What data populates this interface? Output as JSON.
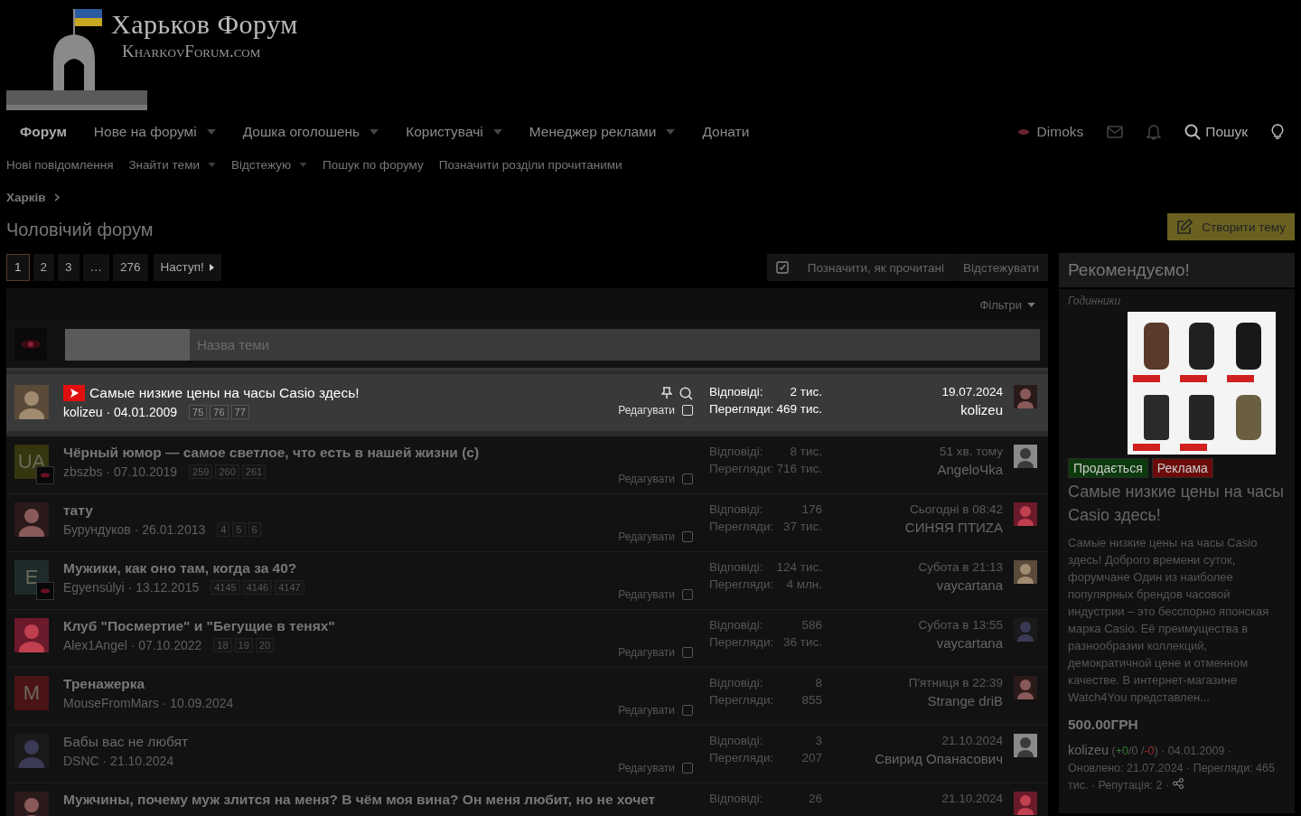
{
  "logo": {
    "title": "Харьков Форум",
    "subtitle": "KharkovForum.com"
  },
  "nav": [
    {
      "label": "Форум",
      "selected": true,
      "dropdown": false
    },
    {
      "label": "Нове на форумі",
      "selected": false,
      "dropdown": true
    },
    {
      "label": "Дошка оголошень",
      "selected": false,
      "dropdown": true
    },
    {
      "label": "Користувачі",
      "selected": false,
      "dropdown": true
    },
    {
      "label": "Менеджер реклами",
      "selected": false,
      "dropdown": true
    },
    {
      "label": "Донати",
      "selected": false,
      "dropdown": false
    }
  ],
  "user": {
    "name": "Dimoks"
  },
  "search_label": "Пошук",
  "subnav": [
    {
      "label": "Нові повідомлення",
      "dropdown": false
    },
    {
      "label": "Знайти теми",
      "dropdown": true
    },
    {
      "label": "Відстежую",
      "dropdown": true
    },
    {
      "label": "Пошук по форуму",
      "dropdown": false
    },
    {
      "label": "Позначити розділи прочитаними",
      "dropdown": false
    }
  ],
  "breadcrumb": [
    "Харків"
  ],
  "page_title": "Чоловічий форум",
  "create_button": "Створити тему",
  "pagination": {
    "pages": [
      {
        "label": "1",
        "selected": true
      },
      {
        "label": "2",
        "selected": false
      },
      {
        "label": "3",
        "selected": false
      },
      {
        "label": "…",
        "selected": false
      },
      {
        "label": "276",
        "selected": false
      }
    ],
    "next": "Наступ!"
  },
  "toolbar": [
    "Позначити, як прочитані",
    "Відстежувати"
  ],
  "filters": "Фільтри",
  "new_thread": {
    "placeholder": "Назва теми"
  },
  "threads": [
    {
      "sticky": true,
      "unread": false,
      "video": true,
      "pinned": true,
      "title": "Самые низкие цены на часы Casio здесь!",
      "byline": "kolizeu · 04.01.2009",
      "pages": [
        "75",
        "76",
        "77"
      ],
      "edit": "Редагувати",
      "checked": false,
      "replies_label": "Відповіді:",
      "replies": "2 тис.",
      "views_label": "Перегляди:",
      "views": "469 тис.",
      "last_date": "19.07.2024",
      "last_user": "kolizeu"
    },
    {
      "sticky": false,
      "unread": true,
      "video": false,
      "pinned": false,
      "avatar": {
        "kind": "letter",
        "letter": "UA",
        "color": "#35350f",
        "badge": true
      },
      "title": "Чёрный юмор — самое светлое, что есть в нашей жизни (c)",
      "byline": "zbszbs · 07.10.2019",
      "pages": [
        "259",
        "260",
        "261"
      ],
      "edit": "Редагувати",
      "checked": false,
      "replies_label": "Відповіді:",
      "replies": "8 тис.",
      "views_label": "Перегляди:",
      "views": "716 тис.",
      "last_date": "51 хв. тому",
      "last_user": "AngeloЧka"
    },
    {
      "sticky": false,
      "unread": true,
      "video": false,
      "pinned": false,
      "title": "тату",
      "byline": "Бурундуков · 26.01.2013",
      "pages": [
        "4",
        "5",
        "6"
      ],
      "edit": "Редагувати",
      "checked": false,
      "replies_label": "Відповіді:",
      "replies": "176",
      "views_label": "Перегляди:",
      "views": "37 тис.",
      "last_date": "Сьогодні в 08:42",
      "last_user": "СИНЯЯ ПТИZА"
    },
    {
      "sticky": false,
      "unread": true,
      "video": false,
      "pinned": false,
      "avatar": {
        "kind": "letter",
        "letter": "E",
        "color": "#1e2b2b",
        "badge": true
      },
      "title": "Мужики, как оно там, когда за 40?",
      "byline": "Egyensúlyi · 13.12.2015",
      "pages": [
        "4145",
        "4146",
        "4147"
      ],
      "edit": "Редагувати",
      "checked": false,
      "replies_label": "Відповіді:",
      "replies": "124 тис.",
      "views_label": "Перегляди:",
      "views": "4 млн.",
      "last_date": "Субота в 21:13",
      "last_user": "vaycartana"
    },
    {
      "sticky": false,
      "unread": true,
      "video": false,
      "pinned": false,
      "title": "Клуб \"Посмертие\" и \"Бегущие в тенях\"",
      "byline": "Alex1Angel · 07.10.2022",
      "pages": [
        "18",
        "19",
        "20"
      ],
      "edit": "Редагувати",
      "checked": false,
      "replies_label": "Відповіді:",
      "replies": "586",
      "views_label": "Перегляди:",
      "views": "36 тис.",
      "last_date": "Субота в 13:55",
      "last_user": "vaycartana"
    },
    {
      "sticky": false,
      "unread": true,
      "video": false,
      "pinned": false,
      "avatar": {
        "kind": "letter",
        "letter": "M",
        "color": "#4a1414",
        "badge": false
      },
      "title": "Тренажерка",
      "byline": "MouseFromMars · 10.09.2024",
      "edit": "Редагувати",
      "checked": false,
      "replies_label": "Відповіді:",
      "replies": "8",
      "views_label": "Перегляди:",
      "views": "855",
      "last_date": "П'ятниця в 22:39",
      "last_user": "Strange driB"
    },
    {
      "sticky": false,
      "unread": false,
      "video": false,
      "pinned": false,
      "title": "Бабы вас не любят",
      "byline": "DSNC · 21.10.2024",
      "edit": "Редагувати",
      "checked": false,
      "replies_label": "Відповіді:",
      "replies": "3",
      "views_label": "Перегляди:",
      "views": "207",
      "last_date": "21.10.2024",
      "last_user": "Свирид Опанасович"
    },
    {
      "sticky": false,
      "unread": true,
      "video": false,
      "pinned": false,
      "title": "Мужчины, почему муж злится на меня? В чём моя вина? Он меня любит, но не хочет",
      "replies_label": "Відповіді:",
      "replies": "26",
      "last_date": "21.10.2024"
    }
  ],
  "sidebar": {
    "title": "Рекомендуємо!",
    "category": "Годинники",
    "tags": [
      {
        "label": "Продається",
        "color": "#0c3a0c"
      },
      {
        "label": "Реклама",
        "color": "#6a0a0a"
      }
    ],
    "headline": "Самые низкие цены на часы Casio здесь!",
    "text": "Самые низкие цены на часы Casio здесь! Доброго времени суток, форумчане Один из наиболее популярных брендов часовой индустрии – это бесспорно японская марка Casio. Её преимущества в разнообразии коллекций, демократичной цене и отменном качестве. В интернет-магазине Watch4You представлен...",
    "price": "500.00ГРН",
    "author": "kolizeu",
    "open": "(",
    "plus": "+0",
    "neutral": "/0 /",
    "minus": "-0",
    "meta": ") · 04.01.2009 · Оновлено: 21.07.2024 · Перегляди: 465 тис. · Репутація: 2 ·"
  }
}
